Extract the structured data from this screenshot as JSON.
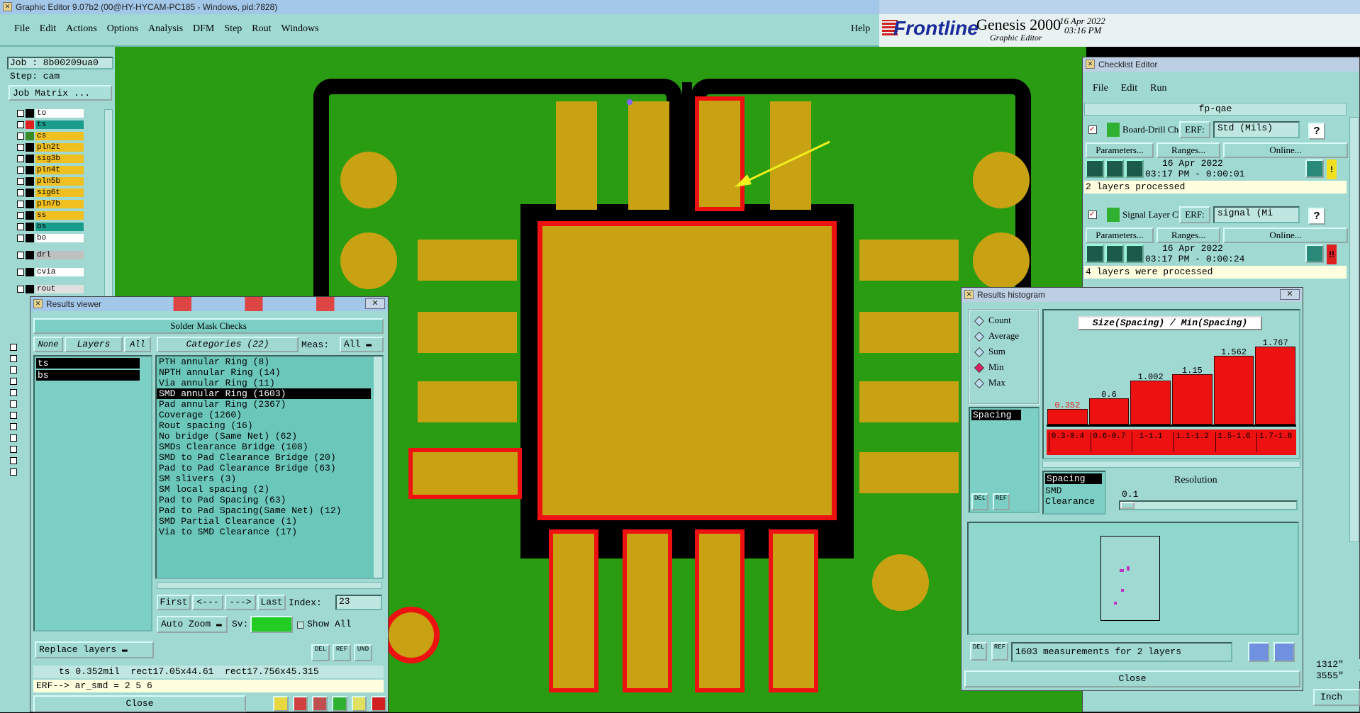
{
  "app": {
    "title": "Graphic Editor 9.07b2 (00@HY-HYCAM-PC185 - Windows, pid:7828)"
  },
  "menu": {
    "items": [
      "File",
      "Edit",
      "Actions",
      "Options",
      "Analysis",
      "DFM",
      "Step",
      "Rout",
      "Windows"
    ],
    "help": "Help"
  },
  "brand": {
    "logo": "Frontline",
    "product": "Genesis 2000",
    "subtitle": "Graphic Editor",
    "date": "16 Apr 2022",
    "time": "03:16 PM"
  },
  "job": {
    "job_label": "Job : 8b00209ua0",
    "step_label": "Step: cam",
    "matrix_button": "Job Matrix ..."
  },
  "layers": [
    {
      "name": "to",
      "color": "#ffffff",
      "swatch": "#000000"
    },
    {
      "name": "ts",
      "color": "#1a9c8c",
      "swatch": "#e02020"
    },
    {
      "name": "cs",
      "color": "#f0c020",
      "swatch": "#3a8a2a"
    },
    {
      "name": "pln2t",
      "color": "#f0c020",
      "swatch": "#000000"
    },
    {
      "name": "sig3b",
      "color": "#f0c020",
      "swatch": "#000000"
    },
    {
      "name": "pln4t",
      "color": "#f0c020",
      "swatch": "#000000"
    },
    {
      "name": "pln5b",
      "color": "#f0c020",
      "swatch": "#000000"
    },
    {
      "name": "sig6t",
      "color": "#f0c020",
      "swatch": "#000000"
    },
    {
      "name": "pln7b",
      "color": "#f0c020",
      "swatch": "#000000"
    },
    {
      "name": "ss",
      "color": "#f0c020",
      "swatch": "#000000"
    },
    {
      "name": "bs",
      "color": "#1a9c8c",
      "swatch": "#000000"
    },
    {
      "name": "bo",
      "color": "#ffffff",
      "swatch": "#000000"
    },
    {
      "name": "drl",
      "color": "#c0c0c0",
      "swatch": "#000000"
    },
    {
      "name": "cvia",
      "color": "#ffffff",
      "swatch": "#000000"
    },
    {
      "name": "rout",
      "color": "#e0e0e0",
      "swatch": "#000000"
    }
  ],
  "results_viewer": {
    "title": "Results viewer",
    "section": "Solder Mask Checks",
    "none": "None",
    "layers_btn": "Layers",
    "all": "All",
    "categories_btn": "Categories (22)",
    "meas_label": "Meas:",
    "meas_value": "All",
    "selected_layers": [
      "ts",
      "bs"
    ],
    "categories": [
      "PTH annular Ring (8)",
      "NPTH annular Ring (14)",
      "Via annular Ring (11)",
      "SMD annular Ring (1603)",
      "Pad annular Ring (2367)",
      "Coverage (1260)",
      "Rout spacing (16)",
      "No bridge (Same Net) (62)",
      "SMDs Clearance Bridge (108)",
      "SMD to Pad Clearance Bridge (20)",
      "Pad to Pad Clearance Bridge (63)",
      "SM slivers (3)",
      "SM local spacing (2)",
      "Pad to Pad Spacing (63)",
      "Pad to Pad Spacing(Same Net) (12)",
      "SMD Partial Clearance (1)",
      "Via to SMD Clearance (17)"
    ],
    "selected_category": "SMD annular Ring (1603)",
    "first": "First",
    "prev": "<---",
    "next": "--->",
    "last": "Last",
    "index_label": "Index:",
    "index_value": "23",
    "auto_zoom": "Auto Zoom",
    "sv_label": "Sv:",
    "show_all": "Show All",
    "replace_layers": "Replace layers",
    "status": "ts 0.352mil  rect17.05x44.61  rect17.756x45.315",
    "erf": "ERF--> ar_smd = 2 5 6",
    "close": "Close",
    "del": "DEL",
    "ref": "REF",
    "und": "UND"
  },
  "checklist": {
    "title": "Checklist Editor",
    "menu": [
      "File",
      "Edit",
      "Run"
    ],
    "name": "fp-qae",
    "items": [
      {
        "name": "Board-Drill Che",
        "erf": "ERF:",
        "erf_value": "Std (Mils)",
        "params": "Parameters...",
        "ranges": "Ranges...",
        "online": "Online...",
        "date": "16 Apr 2022",
        "time": "03:17 PM - 0:00:01",
        "status": "2 layers processed",
        "flag": "!",
        "flag_color": "#f0e020"
      },
      {
        "name": "Signal Layer Ch",
        "erf": "ERF:",
        "erf_value": "signal (Mi",
        "params": "Parameters...",
        "ranges": "Ranges...",
        "online": "Online...",
        "date": "16 Apr 2022",
        "time": "03:17 PM - 0:00:24",
        "status": "4 layers were processed",
        "flag": "!!",
        "flag_color": "#e02020"
      }
    ],
    "help": "?"
  },
  "histogram": {
    "title": "Results histogram",
    "radios": [
      "Count",
      "Average",
      "Sum",
      "Min",
      "Max"
    ],
    "selected_radio": "Min",
    "list_top": [
      "Spacing"
    ],
    "chart_title": "Size(Spacing) / Min(Spacing)",
    "resolution_label": "Resolution",
    "resolution_value": "0.1",
    "list_bottom": [
      "Spacing",
      "SMD",
      "Clearance"
    ],
    "summary": "1603 measurements for 2 layers",
    "close": "Close",
    "del": "DEL",
    "ref": "REF"
  },
  "chart_data": {
    "type": "bar",
    "title": "Size(Spacing) / Min(Spacing)",
    "categories": [
      "0.3-0.4",
      "0.6-0.7",
      "1-1.1",
      "1.1-1.2",
      "1.5-1.6",
      "1.7-1.8"
    ],
    "values": [
      0.352,
      0.6,
      1.002,
      1.15,
      1.562,
      1.767
    ],
    "ylim": [
      0,
      2.0
    ],
    "bar_color": "#ee1111",
    "label_color_first": "#e02020"
  },
  "right_edge": {
    "coord1": "1312\"",
    "coord2": "3555\"",
    "units": "Inch"
  }
}
